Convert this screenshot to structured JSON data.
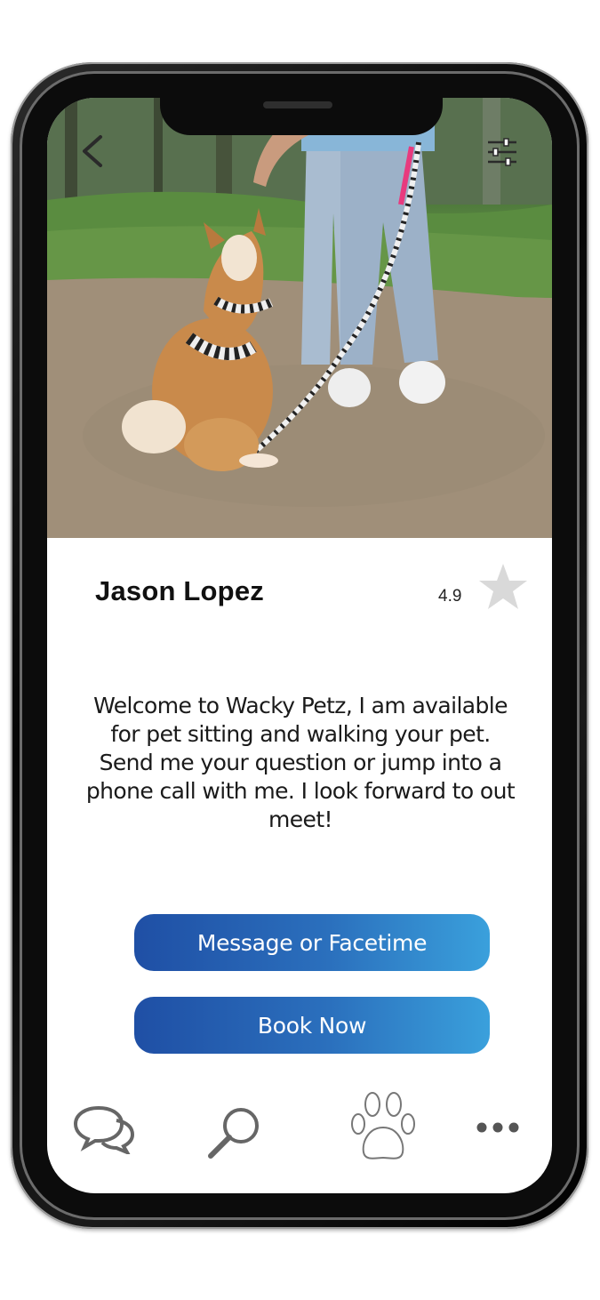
{
  "profile": {
    "name": "Jason Lopez",
    "rating": "4.9",
    "bio": "Welcome to Wacky Petz, I am available for pet sitting and walking your pet. Send me your question or jump into a phone call with me. I look forward to out meet!"
  },
  "actions": {
    "message_label": "Message or Facetime",
    "book_label": "Book Now"
  },
  "header": {
    "back_icon": "chevron-left-icon",
    "filter_icon": "sliders-icon"
  },
  "tabbar": {
    "items": [
      "chat-bubbles-icon",
      "search-icon",
      "paw-icon",
      "more-icon"
    ]
  },
  "colors": {
    "button_gradient_start": "#1f4fa5",
    "button_gradient_end": "#3aa0dc",
    "star": "#d9d9d9",
    "icon": "#666666"
  }
}
